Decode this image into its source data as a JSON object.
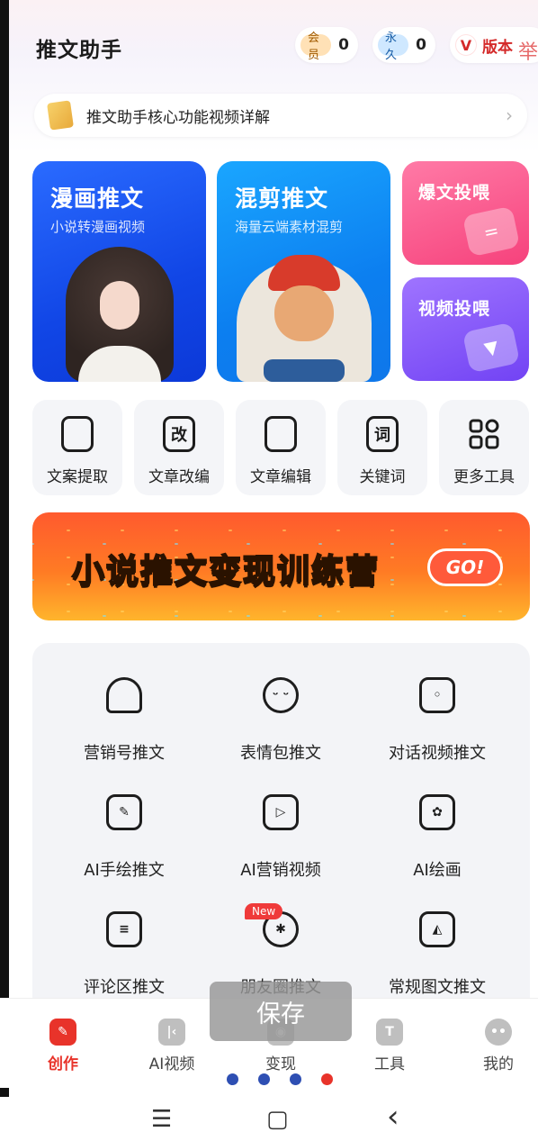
{
  "header": {
    "title": "推文助手",
    "member_tag": "会员",
    "member_count": "0",
    "forever_tag": "永久",
    "forever_count": "0",
    "version_badge": "V",
    "version_label": "版本",
    "watermark": "举"
  },
  "notice": {
    "text": "推文助手核心功能视频详解",
    "arrow": "›"
  },
  "cards": {
    "comic": {
      "title": "漫画推文",
      "subtitle": "小说转漫画视频"
    },
    "mix": {
      "title": "混剪推文",
      "subtitle": "海量云端素材混剪"
    },
    "explode": {
      "title": "爆文投喂"
    },
    "video": {
      "title": "视频投喂"
    }
  },
  "tools": [
    {
      "label": "文案提取",
      "glyph": ""
    },
    {
      "label": "文章改编",
      "glyph": "改"
    },
    {
      "label": "文章编辑",
      "glyph": ""
    },
    {
      "label": "关键词",
      "glyph": "词"
    },
    {
      "label": "更多工具",
      "glyph": ""
    }
  ],
  "banner": {
    "part1": "小说推文",
    "highlight": "变现",
    "part2": "训练营",
    "go": "GO!"
  },
  "grid": [
    {
      "label": "营销号推文",
      "icon": "person-icon"
    },
    {
      "label": "表情包推文",
      "icon": "emoji-icon"
    },
    {
      "label": "对话视频推文",
      "icon": "chat-bubble-icon"
    },
    {
      "label": "AI手绘推文",
      "icon": "drawing-icon"
    },
    {
      "label": "AI营销视频",
      "icon": "ai-video-icon"
    },
    {
      "label": "AI绘画",
      "icon": "ai-palette-icon"
    },
    {
      "label": "评论区推文",
      "icon": "comment-icon"
    },
    {
      "label": "朋友圈推文",
      "icon": "shutter-icon"
    },
    {
      "label": "常规图文推文",
      "icon": "image-text-icon"
    }
  ],
  "new_badge": "New",
  "toast": "保存",
  "tabs": [
    {
      "label": "创作",
      "active": true
    },
    {
      "label": "AI视频",
      "active": false
    },
    {
      "label": "变现",
      "active": false
    },
    {
      "label": "工具",
      "active": false
    },
    {
      "label": "我的",
      "active": false
    }
  ],
  "system_nav": {
    "menu": "☰",
    "home": "▢",
    "back": "‹"
  },
  "colors": {
    "accent": "#e8332a",
    "comic_card": "#1146e6",
    "mix_card": "#0c7ff0",
    "explode_card": "#f6427c",
    "video_card": "#7243f4"
  }
}
